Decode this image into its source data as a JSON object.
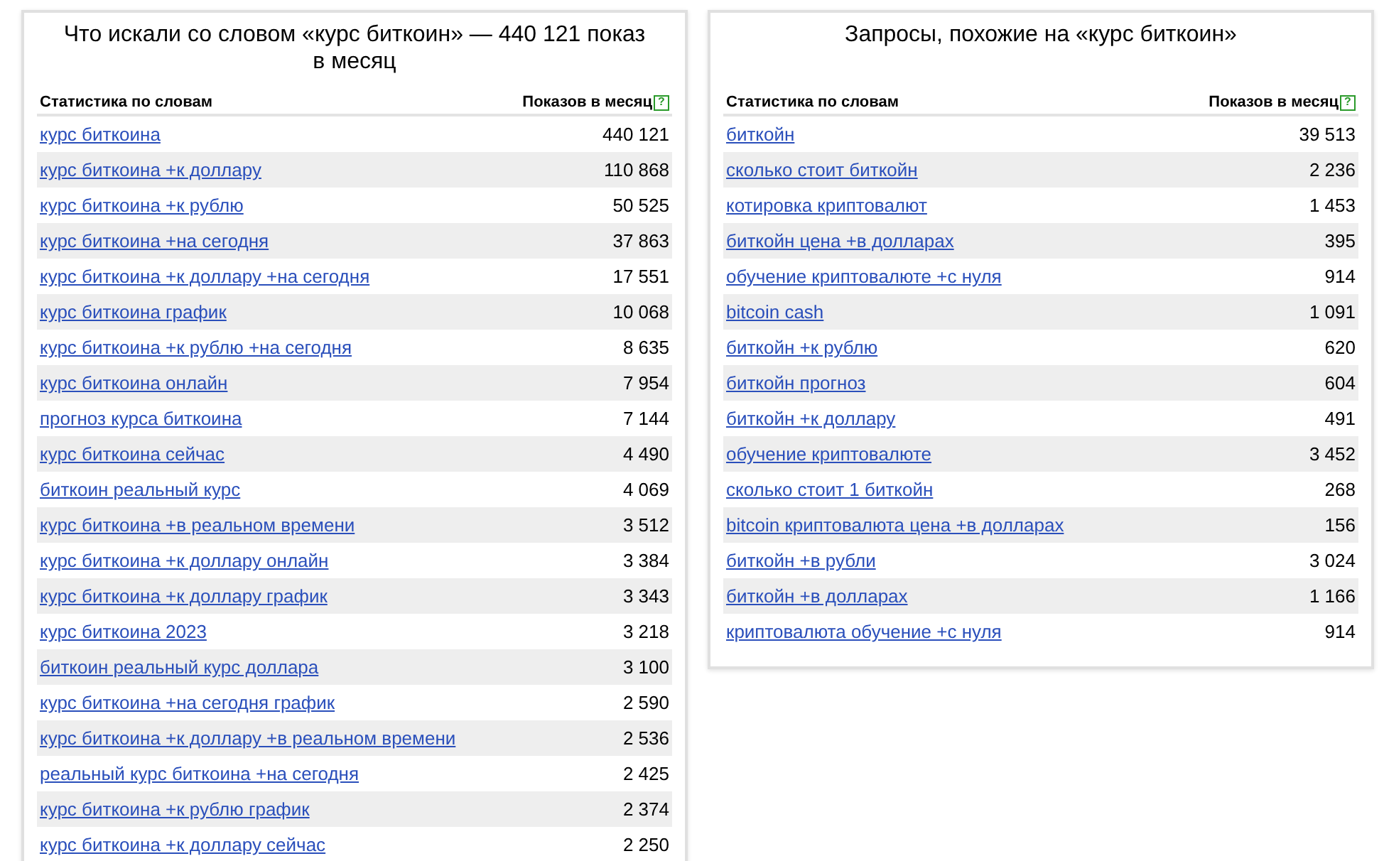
{
  "panels": [
    {
      "title": "Что искали со словом «курс биткоин» — 440 121 показ в месяц",
      "columns": [
        "Статистика по словам",
        "Показов в месяц"
      ],
      "help_icon": "?",
      "rows": [
        {
          "phrase": "курс биткоина",
          "count": "440 121"
        },
        {
          "phrase": "курс биткоина +к доллару",
          "count": "110 868"
        },
        {
          "phrase": "курс биткоина +к рублю",
          "count": "50 525"
        },
        {
          "phrase": "курс биткоина +на сегодня",
          "count": "37 863"
        },
        {
          "phrase": "курс биткоина +к доллару +на сегодня",
          "count": "17 551"
        },
        {
          "phrase": "курс биткоина график",
          "count": "10 068"
        },
        {
          "phrase": "курс биткоина +к рублю +на сегодня",
          "count": "8 635"
        },
        {
          "phrase": "курс биткоина онлайн",
          "count": "7 954"
        },
        {
          "phrase": "прогноз курса биткоина",
          "count": "7 144"
        },
        {
          "phrase": "курс биткоина сейчас",
          "count": "4 490"
        },
        {
          "phrase": "биткоин реальный курс",
          "count": "4 069"
        },
        {
          "phrase": "курс биткоина +в реальном времени",
          "count": "3 512"
        },
        {
          "phrase": "курс биткоина +к доллару онлайн",
          "count": "3 384"
        },
        {
          "phrase": "курс биткоина +к доллару график",
          "count": "3 343"
        },
        {
          "phrase": "курс биткоина 2023",
          "count": "3 218"
        },
        {
          "phrase": "биткоин реальный курс доллара",
          "count": "3 100"
        },
        {
          "phrase": "курс биткоина +на сегодня график",
          "count": "2 590"
        },
        {
          "phrase": "курс биткоина +к доллару +в реальном времени",
          "count": "2 536"
        },
        {
          "phrase": "реальный курс биткоина +на сегодня",
          "count": "2 425"
        },
        {
          "phrase": "курс биткоина +к рублю график",
          "count": "2 374"
        },
        {
          "phrase": "курс биткоина +к доллару сейчас",
          "count": "2 250"
        }
      ]
    },
    {
      "title": "Запросы, похожие на «курс биткоин»",
      "columns": [
        "Статистика по словам",
        "Показов в месяц"
      ],
      "help_icon": "?",
      "rows": [
        {
          "phrase": "биткойн",
          "count": "39 513"
        },
        {
          "phrase": "сколько стоит биткойн",
          "count": "2 236"
        },
        {
          "phrase": "котировка криптовалют",
          "count": "1 453"
        },
        {
          "phrase": "биткойн цена +в долларах",
          "count": "395"
        },
        {
          "phrase": "обучение криптовалюте +с нуля",
          "count": "914"
        },
        {
          "phrase": "bitcoin cash",
          "count": "1 091"
        },
        {
          "phrase": "биткойн +к рублю",
          "count": "620"
        },
        {
          "phrase": "биткойн прогноз",
          "count": "604"
        },
        {
          "phrase": "биткойн +к доллару",
          "count": "491"
        },
        {
          "phrase": "обучение криптовалюте",
          "count": "3 452"
        },
        {
          "phrase": "сколько стоит 1 биткойн",
          "count": "268"
        },
        {
          "phrase": "bitcoin криптовалюта цена +в долларах",
          "count": "156"
        },
        {
          "phrase": "биткойн +в рубли",
          "count": "3 024"
        },
        {
          "phrase": "биткойн +в долларах",
          "count": "1 166"
        },
        {
          "phrase": "криптовалюта обучение +с нуля",
          "count": "914"
        }
      ]
    }
  ]
}
